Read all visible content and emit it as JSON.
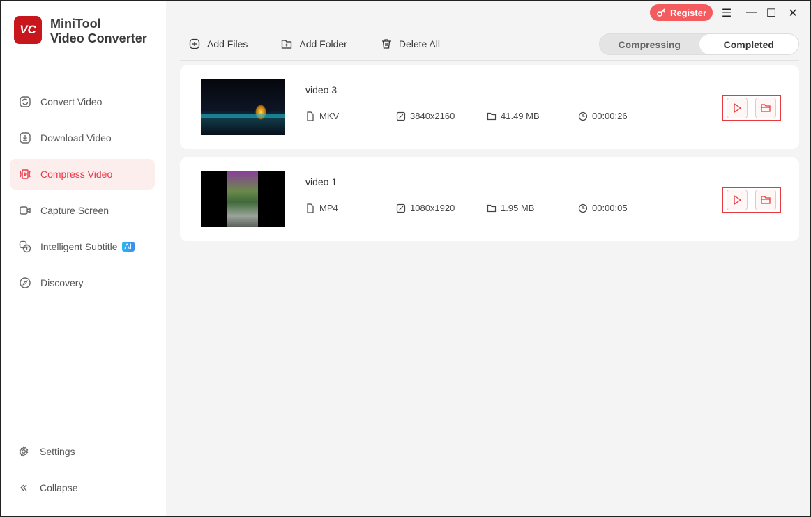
{
  "app": {
    "logo_text": "VC",
    "name_line1": "MiniTool",
    "name_line2": "Video Converter"
  },
  "sidebar": {
    "items": [
      {
        "label": "Convert Video"
      },
      {
        "label": "Download Video"
      },
      {
        "label": "Compress Video",
        "active": true
      },
      {
        "label": "Capture Screen"
      },
      {
        "label": "Intelligent Subtitle",
        "badge": "AI"
      },
      {
        "label": "Discovery"
      }
    ],
    "settings": "Settings",
    "collapse": "Collapse"
  },
  "header": {
    "register": "Register"
  },
  "toolbar": {
    "add_files": "Add Files",
    "add_folder": "Add Folder",
    "delete_all": "Delete All"
  },
  "tabs": {
    "compressing": "Compressing",
    "completed": "Completed",
    "active": "completed"
  },
  "videos": [
    {
      "name": "video 3",
      "format": "MKV",
      "resolution": "3840x2160",
      "size": "41.49 MB",
      "duration": "00:00:26"
    },
    {
      "name": "video 1",
      "format": "MP4",
      "resolution": "1080x1920",
      "size": "1.95 MB",
      "duration": "00:00:05"
    }
  ],
  "colors": {
    "accent": "#e8394a",
    "register": "#f45b5f"
  }
}
